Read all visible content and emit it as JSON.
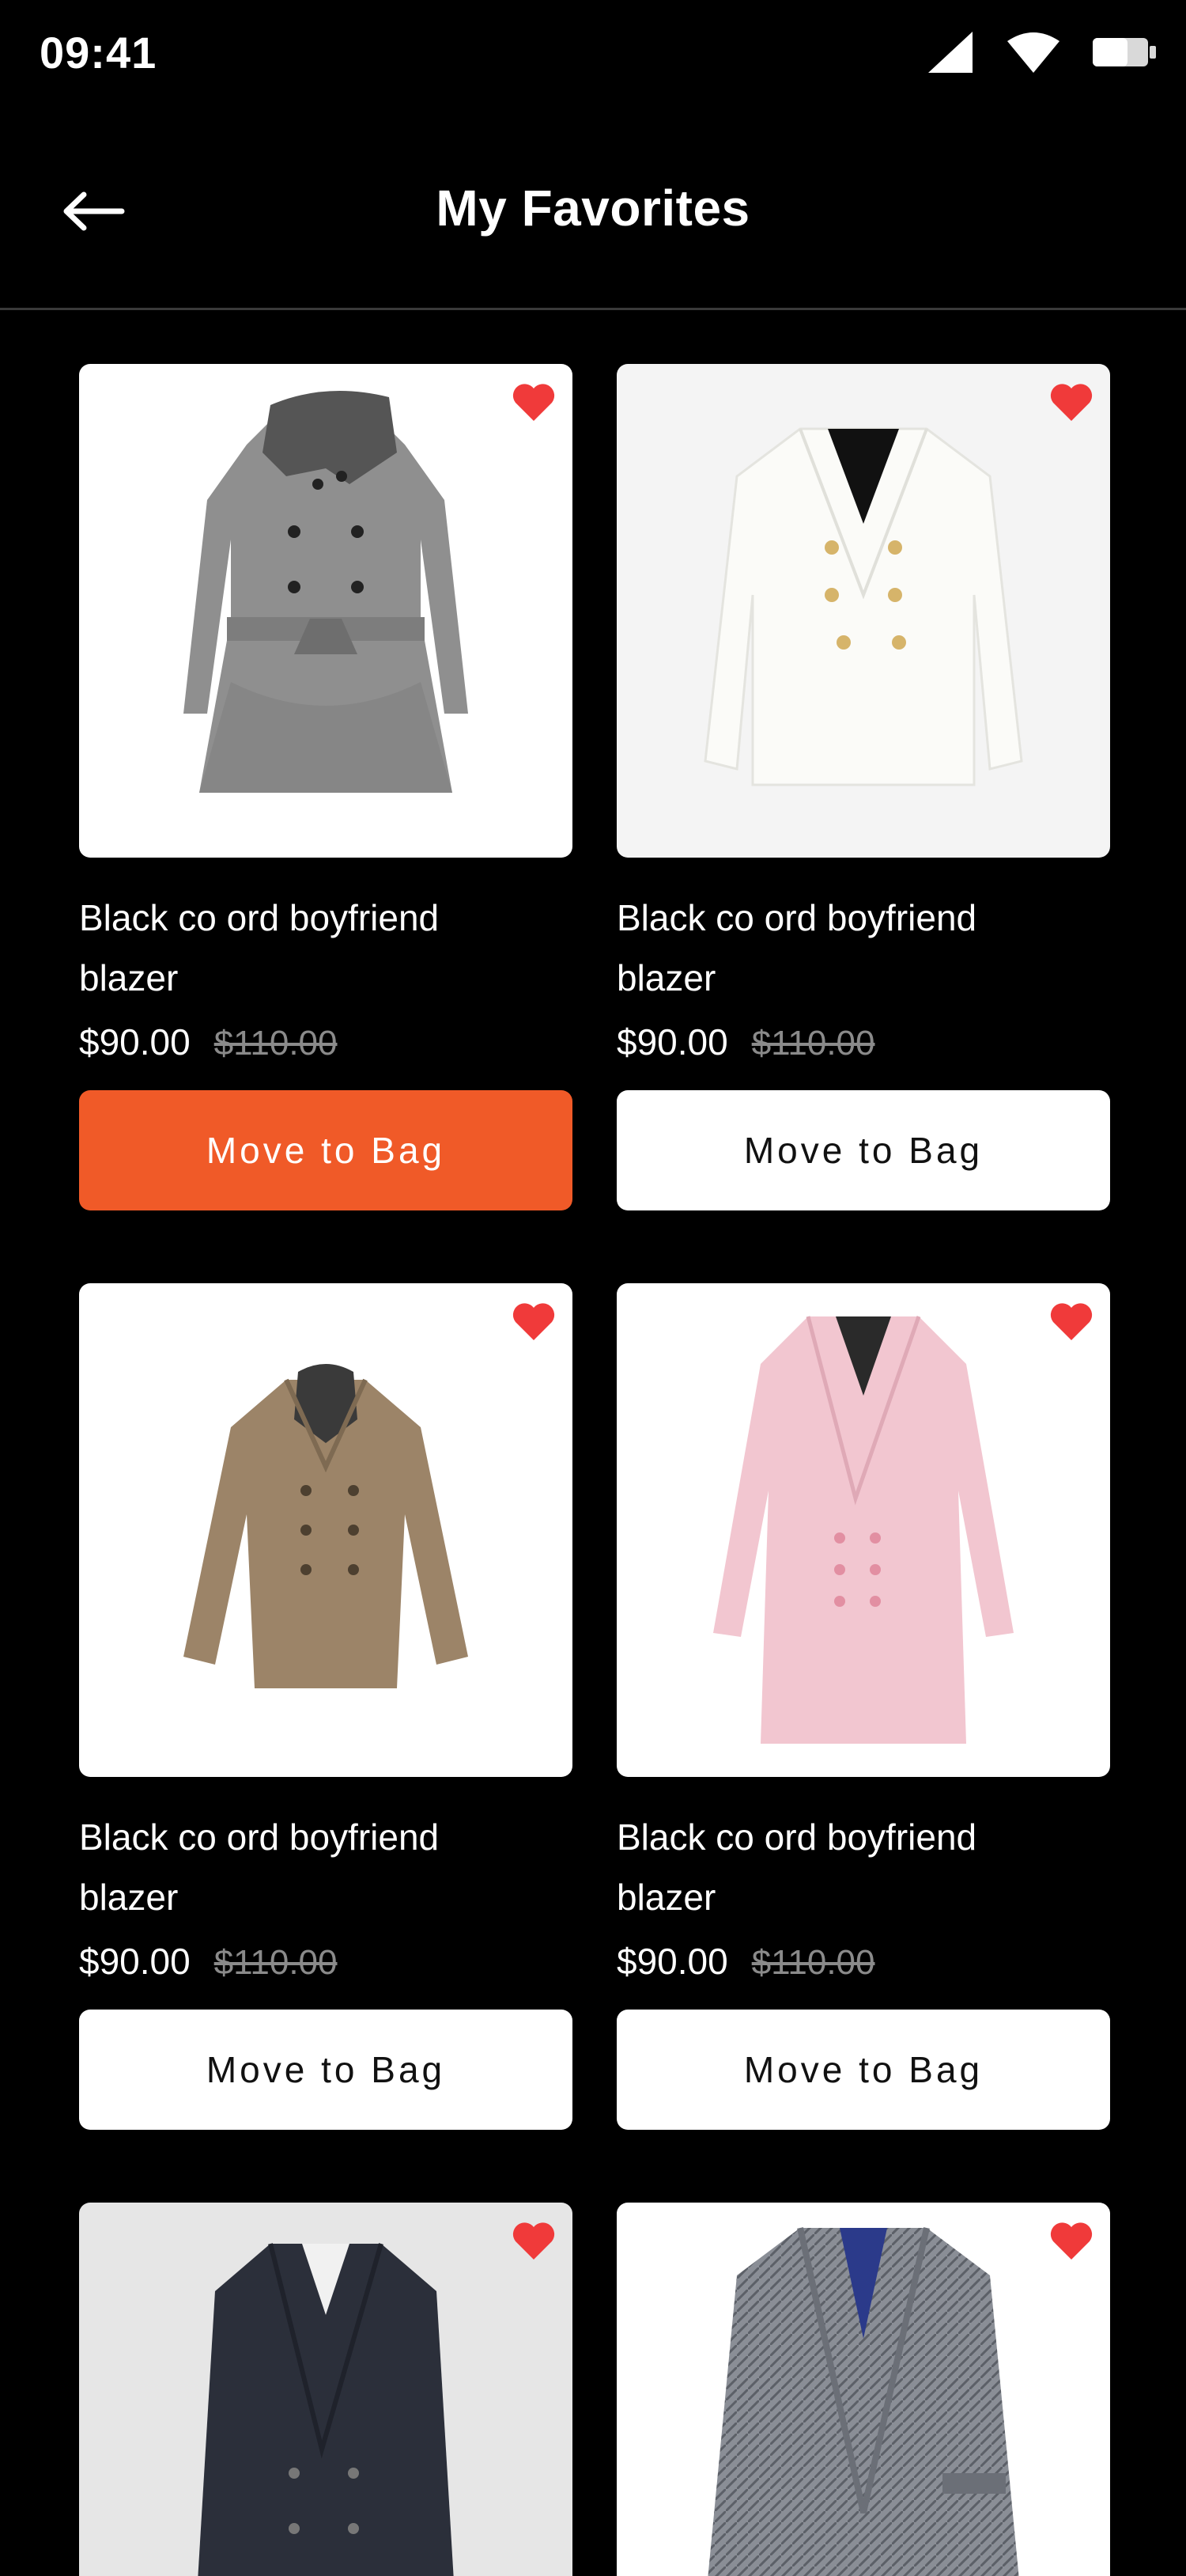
{
  "status_bar": {
    "time": "09:41"
  },
  "header": {
    "title": "My Favorites"
  },
  "colors": {
    "accent": "#f05a28",
    "heart": "#f03a3a",
    "background": "#000000"
  },
  "products": [
    {
      "name": "Black co ord  boyfriend blazer",
      "price": "$90.00",
      "old_price": "$110.00",
      "button": "Move to Bag",
      "image": "grey-fur-collar-coat",
      "favorite": true,
      "active": true
    },
    {
      "name": "Black co ord  boyfriend blazer",
      "price": "$90.00",
      "old_price": "$110.00",
      "button": "Move to Bag",
      "image": "white-double-breasted-blazer",
      "favorite": true,
      "active": false
    },
    {
      "name": "Black co ord  boyfriend blazer",
      "price": "$90.00",
      "old_price": "$110.00",
      "button": "Move to Bag",
      "image": "brown-pea-coat",
      "favorite": true,
      "active": false
    },
    {
      "name": "Black co ord  boyfriend blazer",
      "price": "$90.00",
      "old_price": "$110.00",
      "button": "Move to Bag",
      "image": "pink-long-coat",
      "favorite": true,
      "active": false
    },
    {
      "name": "",
      "price": "",
      "old_price": "",
      "button": "",
      "image": "navy-double-breasted-coat",
      "favorite": true,
      "active": false
    },
    {
      "name": "",
      "price": "",
      "old_price": "",
      "button": "",
      "image": "grey-tweed-wrap-coat",
      "favorite": true,
      "active": false
    }
  ]
}
